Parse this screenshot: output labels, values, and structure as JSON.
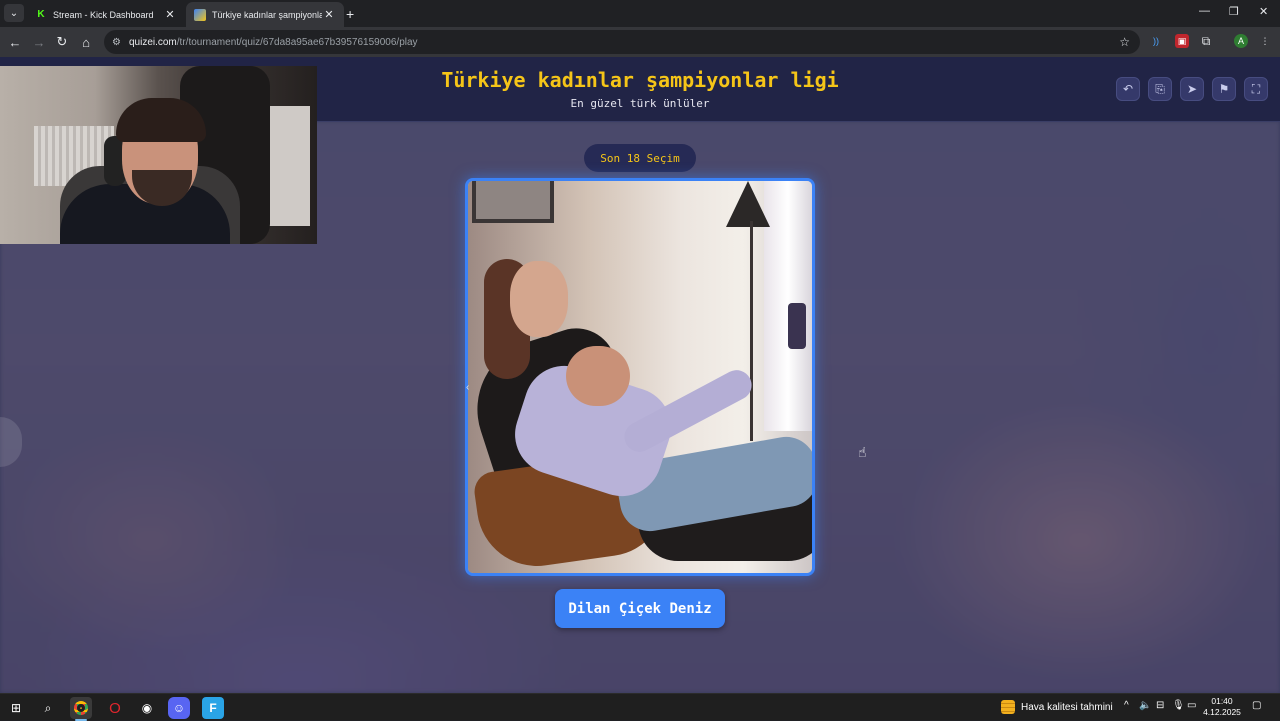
{
  "browser": {
    "tabs": [
      {
        "title": "Stream - Kick Dashboard",
        "favicon": "kick-logo-icon",
        "active": false
      },
      {
        "title": "Türkiye kadınlar şampiyonlar lig",
        "favicon": "quizei-favicon-icon",
        "active": true
      }
    ],
    "url_host": "quizei.com",
    "url_path": "/tr/tournament/quiz/67da8a95ae67b39576159006/play",
    "window_controls": [
      "minimize",
      "restore",
      "close"
    ]
  },
  "quiz": {
    "title": "Türkiye kadınlar şampiyonlar ligi",
    "subtitle": "En güzel türk ünlüler",
    "round_label": "Son 18 Seçim",
    "candidate_name": "Dilan Çiçek Deniz",
    "header_icons": [
      "undo-icon",
      "share-icon",
      "send-icon",
      "flag-icon",
      "fullscreen-icon"
    ],
    "accent_color": "#3b82f6",
    "title_color": "#f5c518",
    "header_bg": "#212446"
  },
  "taskbar": {
    "weather_text": "Hava kalitesi tahmini",
    "time": "01:40",
    "date": "4.12.2025",
    "pinned": [
      "start-icon",
      "search-icon",
      "chrome-icon",
      "opera-icon",
      "obs-icon",
      "discord-icon",
      "app-f-icon"
    ]
  }
}
